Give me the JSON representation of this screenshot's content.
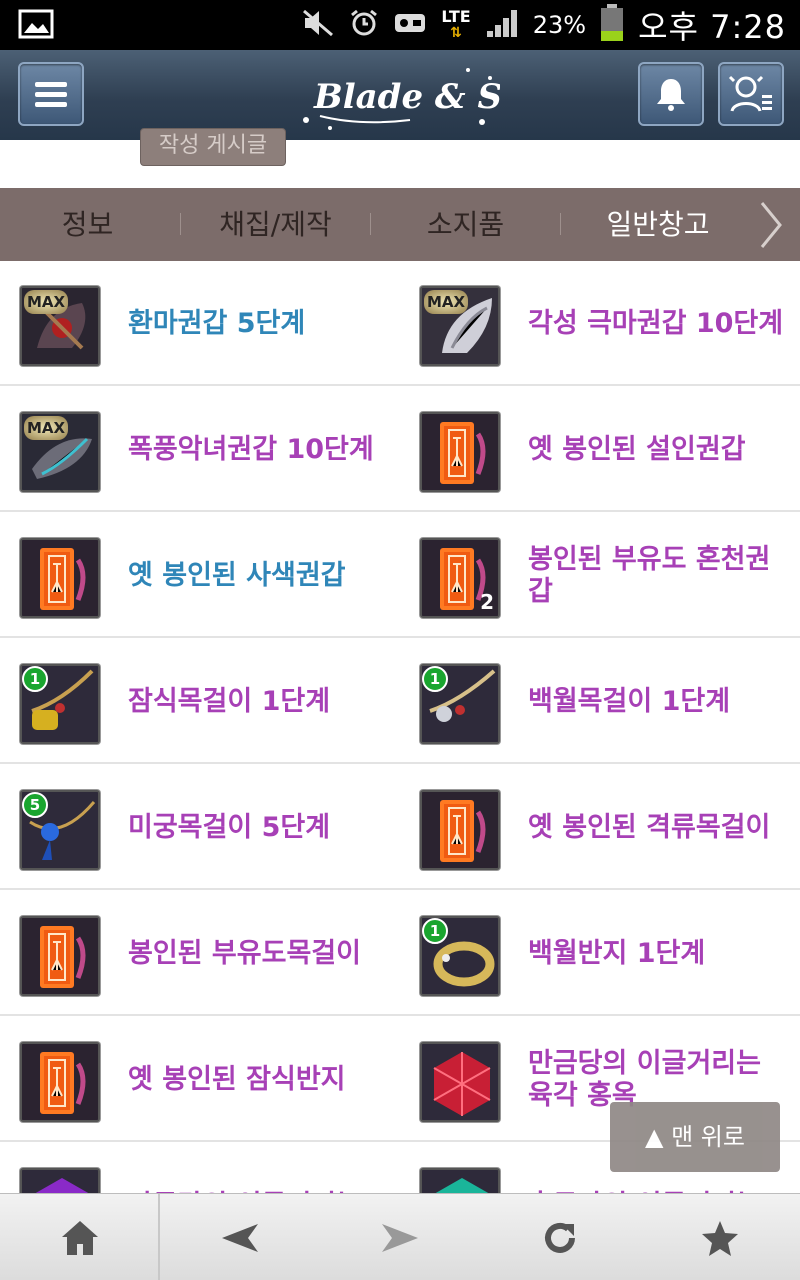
{
  "status_bar": {
    "network": "LTE",
    "battery": "23%",
    "clock": "오후 7:28"
  },
  "header": {
    "logo_text": "Blade & Soul",
    "subnav_label": "작성 게시글"
  },
  "tabs": [
    {
      "label": "정보",
      "active": false
    },
    {
      "label": "채집/제작",
      "active": false
    },
    {
      "label": "소지품",
      "active": false
    },
    {
      "label": "일반창고",
      "active": true
    }
  ],
  "colors": {
    "tab_bar": "#7c6c6a",
    "name_blue": "#2f86b8",
    "name_purple": "#a740b6",
    "header": "#2f3f52"
  },
  "items": [
    [
      {
        "name": "환마권갑 5단계",
        "color": "blue",
        "badge": "MAX",
        "icon": "gauntlet-red"
      },
      {
        "name": "각성 극마권갑 10단계",
        "color": "purple",
        "badge": "MAX",
        "icon": "gauntlet-white"
      }
    ],
    [
      {
        "name": "폭풍악녀권갑 10단계",
        "color": "purple",
        "badge": "MAX",
        "icon": "gauntlet-dark"
      },
      {
        "name": "옛 봉인된 설인권갑",
        "color": "purple",
        "badge": "",
        "icon": "sealed-talisman"
      }
    ],
    [
      {
        "name": "옛 봉인된 사색권갑",
        "color": "blue",
        "badge": "",
        "icon": "sealed-talisman"
      },
      {
        "name": "봉인된 부유도 혼천권갑",
        "color": "purple",
        "badge": "",
        "icon": "sealed-talisman",
        "count": "2"
      }
    ],
    [
      {
        "name": "잠식목걸이 1단계",
        "color": "purple",
        "badge": "1",
        "icon": "necklace-gold"
      },
      {
        "name": "백월목걸이 1단계",
        "color": "purple",
        "badge": "1",
        "icon": "necklace-silver"
      }
    ],
    [
      {
        "name": "미궁목걸이 5단계",
        "color": "purple",
        "badge": "5",
        "icon": "necklace-blue"
      },
      {
        "name": "옛 봉인된 격류목걸이",
        "color": "purple",
        "badge": "",
        "icon": "sealed-talisman"
      }
    ],
    [
      {
        "name": "봉인된 부유도목걸이",
        "color": "purple",
        "badge": "",
        "icon": "sealed-talisman"
      },
      {
        "name": "백월반지 1단계",
        "color": "purple",
        "badge": "1",
        "icon": "ring-gold"
      }
    ],
    [
      {
        "name": "옛 봉인된 잠식반지",
        "color": "purple",
        "badge": "",
        "icon": "sealed-talisman"
      },
      {
        "name": "만금당의 이글거리는 육각 홍옥",
        "color": "purple",
        "badge": "",
        "icon": "gem-red"
      }
    ],
    [
      {
        "name": "만금당의 이글거리는",
        "color": "purple",
        "badge": "",
        "icon": "gem-purple"
      },
      {
        "name": "흑무파의 이글거리는",
        "color": "purple",
        "badge": "",
        "icon": "gem-teal"
      }
    ]
  ],
  "back_to_top": "▲ 맨 위로",
  "bottom_nav": [
    "home-icon",
    "back-arrow-icon",
    "forward-arrow-icon",
    "refresh-icon",
    "bookmark-star-icon"
  ]
}
